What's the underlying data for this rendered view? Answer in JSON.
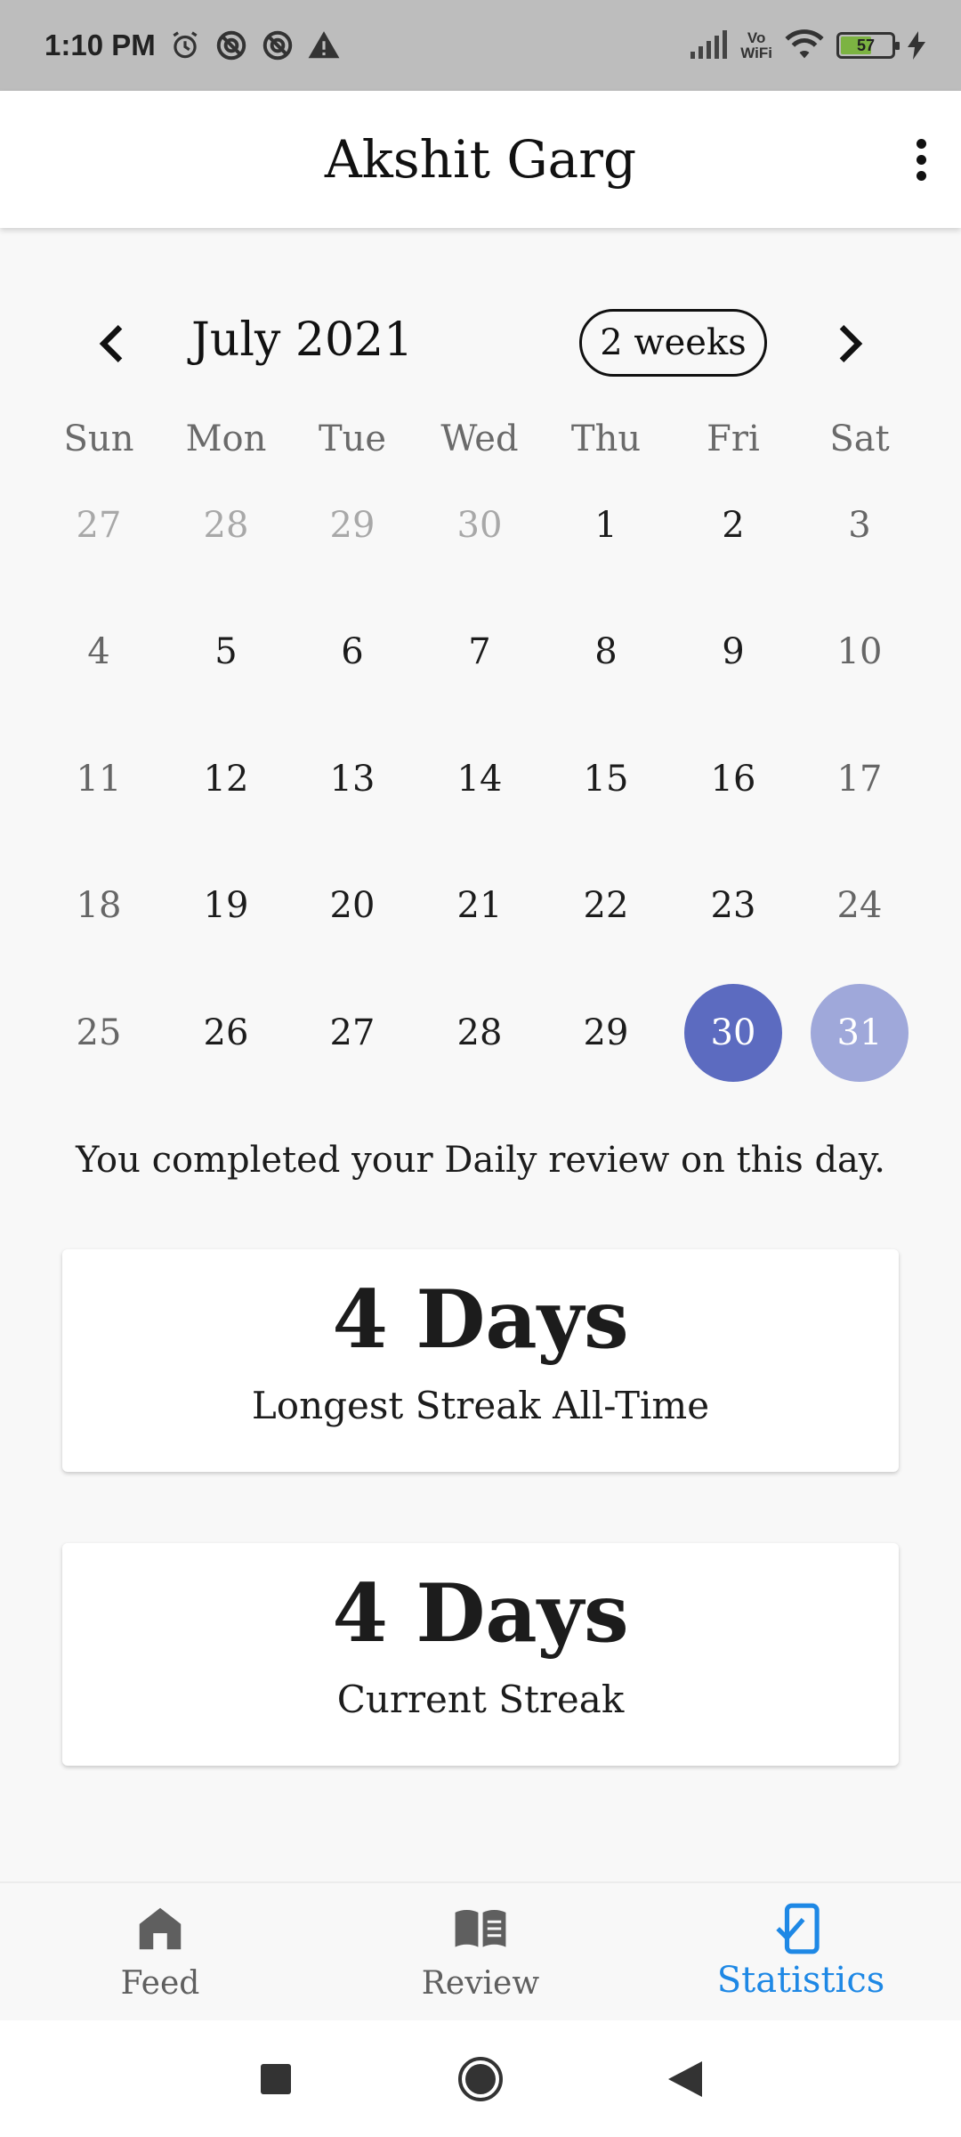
{
  "status_bar": {
    "time": "1:10 PM",
    "battery_level": "57",
    "vowifi": [
      "Vo",
      "WiFi"
    ],
    "icons": [
      "alarm-icon",
      "no-disturb-icon",
      "no-disturb-icon",
      "warning-icon",
      "signal-icon",
      "vowifi-icon",
      "wifi-icon",
      "battery-icon",
      "charging-icon"
    ]
  },
  "app_bar": {
    "title": "Akshit Garg",
    "menu_icon": "more-vert-icon"
  },
  "calendar": {
    "month_title": "July 2021",
    "format_button": "2 weeks",
    "weekdays": [
      "Sun",
      "Mon",
      "Tue",
      "Wed",
      "Thu",
      "Fri",
      "Sat"
    ],
    "weeks": [
      [
        {
          "d": "27",
          "outside": true
        },
        {
          "d": "28",
          "outside": true
        },
        {
          "d": "29",
          "outside": true
        },
        {
          "d": "30",
          "outside": true
        },
        {
          "d": "1"
        },
        {
          "d": "2"
        },
        {
          "d": "3"
        }
      ],
      [
        {
          "d": "4"
        },
        {
          "d": "5"
        },
        {
          "d": "6"
        },
        {
          "d": "7"
        },
        {
          "d": "8"
        },
        {
          "d": "9"
        },
        {
          "d": "10"
        }
      ],
      [
        {
          "d": "11"
        },
        {
          "d": "12"
        },
        {
          "d": "13"
        },
        {
          "d": "14"
        },
        {
          "d": "15"
        },
        {
          "d": "16"
        },
        {
          "d": "17"
        }
      ],
      [
        {
          "d": "18"
        },
        {
          "d": "19"
        },
        {
          "d": "20"
        },
        {
          "d": "21"
        },
        {
          "d": "22"
        },
        {
          "d": "23"
        },
        {
          "d": "24"
        }
      ],
      [
        {
          "d": "25"
        },
        {
          "d": "26"
        },
        {
          "d": "27"
        },
        {
          "d": "28"
        },
        {
          "d": "29"
        },
        {
          "d": "30",
          "selected": true
        },
        {
          "d": "31",
          "today": true
        }
      ]
    ],
    "selected_color": "#5c6bc0",
    "today_color": "#9fa8da"
  },
  "info_text": "You completed your Daily review on this day.",
  "cards": [
    {
      "value": "4 Days",
      "label": "Longest Streak All-Time"
    },
    {
      "value": "4 Days",
      "label": "Current Streak"
    }
  ],
  "bottom_nav": {
    "items": [
      {
        "label": "Feed",
        "icon": "home-icon"
      },
      {
        "label": "Review",
        "icon": "book-icon"
      },
      {
        "label": "Statistics",
        "icon": "statistics-icon",
        "active": true
      }
    ],
    "active_color": "#1e88e5"
  },
  "system_nav": [
    "recents-icon",
    "home-circle-icon",
    "back-icon"
  ]
}
